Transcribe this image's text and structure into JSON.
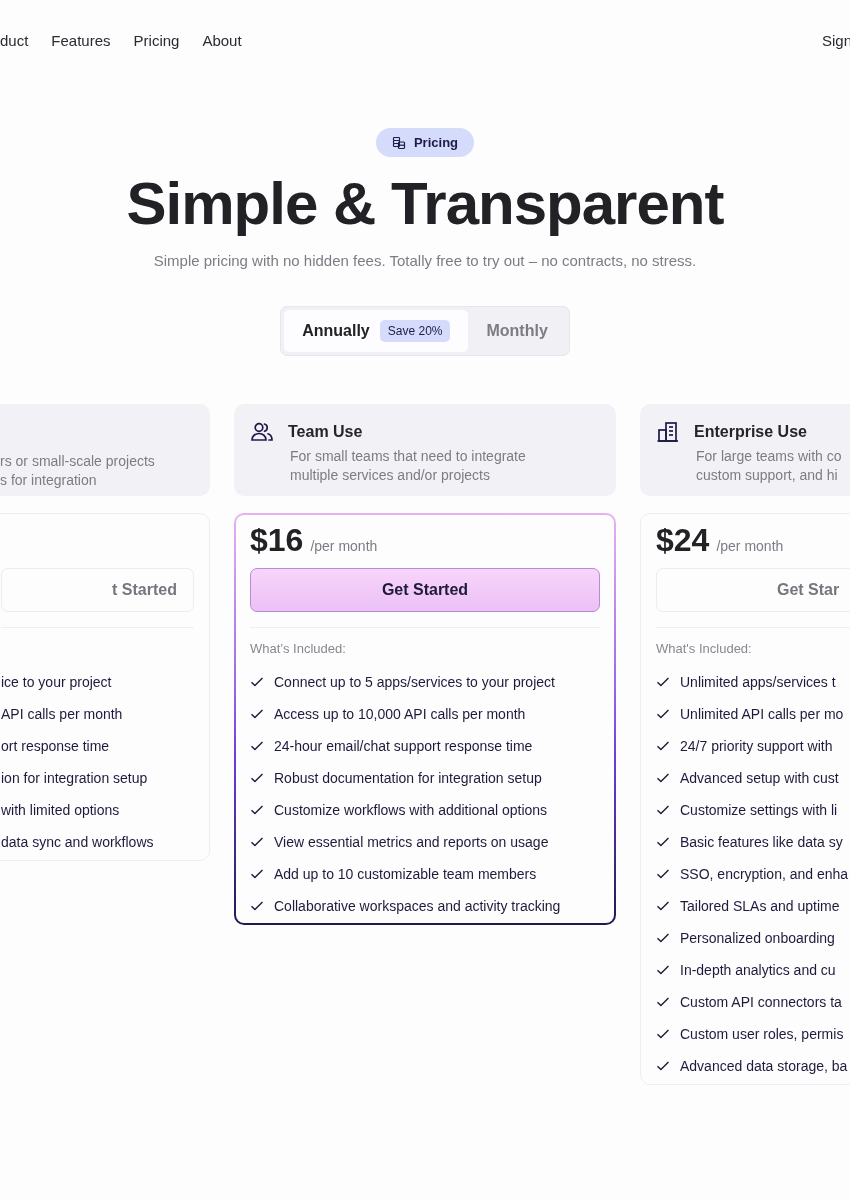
{
  "nav": {
    "links": [
      "duct",
      "Features",
      "Pricing",
      "About"
    ],
    "right_link": "Sign"
  },
  "badge": "Pricing",
  "title": "Simple & Transparent",
  "subtitle": "Simple pricing with no hidden fees. Totally free to try out – no contracts, no stress.",
  "billing_toggle": [
    {
      "label": "Annually",
      "selected": true,
      "tag": "Save 20%"
    },
    {
      "label": "Monthly",
      "selected": false
    }
  ],
  "plans": [
    {
      "kind": "partial",
      "highlighted": false,
      "description_lines": [
        "rs or small-scale projects",
        "s for integration"
      ],
      "button": "t Started",
      "features": [
        "ice to your project",
        "API calls per month",
        "ort response time",
        "ion for integration setup",
        "with limited options",
        "data sync and workflows"
      ]
    },
    {
      "kind": "full",
      "highlighted": true,
      "name": "Team Use",
      "description_lines": [
        "For small teams that need to integrate",
        "multiple services and/or projects"
      ],
      "price": "$16",
      "period": "/per month",
      "button": "Get Started",
      "included_heading": "What’s Included:",
      "features": [
        "Connect up to 5 apps/services to your project",
        "Access up to 10,000 API calls per month",
        "24-hour email/chat support response time",
        "Robust documentation for integration setup",
        "Customize workflows with additional options",
        "View essential metrics and reports on usage",
        "Add up to 10 customizable team members",
        "Collaborative workspaces and activity tracking"
      ]
    },
    {
      "kind": "full",
      "highlighted": false,
      "name": "Enterprise Use",
      "description_lines": [
        "For large teams with co",
        "custom support, and hi"
      ],
      "price": "$24",
      "period": "/per month",
      "button": "Get Star",
      "included_heading": "What's Included:",
      "features": [
        "Unlimited apps/services t",
        "Unlimited API calls per mo",
        "24/7 priority support with",
        "Advanced setup with cust",
        "Customize settings with li",
        "Basic features like data sy",
        "SSO, encryption, and enha",
        "Tailored SLAs and uptime",
        "Personalized onboarding",
        "In-depth analytics and cu",
        "Custom API connectors ta",
        "Custom user roles, permis",
        "Advanced data storage, ba"
      ]
    }
  ]
}
